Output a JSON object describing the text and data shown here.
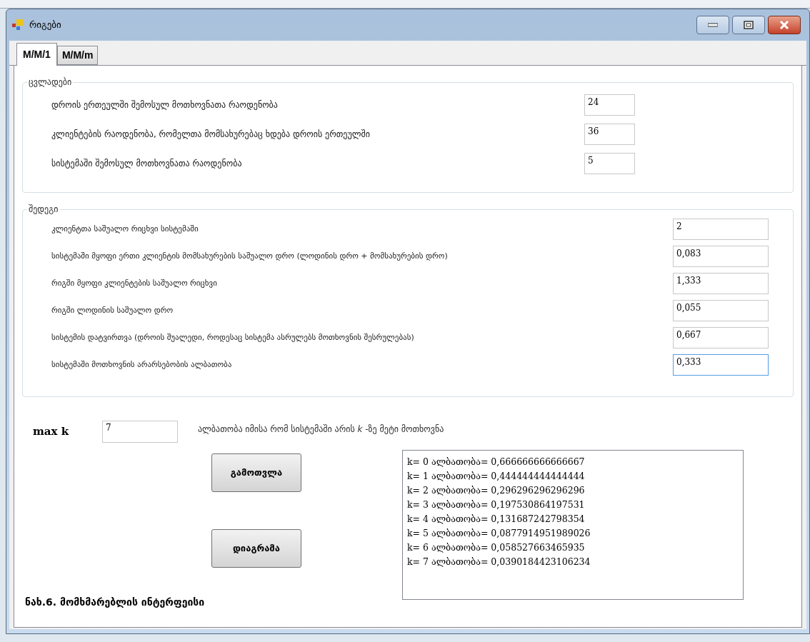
{
  "window": {
    "title": "რიგები"
  },
  "tabs": [
    {
      "label": "M/M/1",
      "selected": true
    },
    {
      "label": "M/M/m",
      "selected": false
    }
  ],
  "variables": {
    "title": "ცვლადები",
    "rows": [
      {
        "label": "დროის ერთეულში შემოსულ მოთხოვნათა რაოდენობა",
        "value": "24"
      },
      {
        "label": "კლიენტების რაოდენობა, რომელთა მომსახურებაც ხდება დროის ერთეულში",
        "value": "36"
      },
      {
        "label": "სისტემაში შემოსულ მოთხოვნათა რაოდენობა",
        "value": "5"
      }
    ]
  },
  "results": {
    "title": "შედეგი",
    "rows": [
      {
        "label": "კლიენტთა საშუალო რიცხვი სისტემაში",
        "value": "2",
        "focused": false
      },
      {
        "label": "სისტემაში მყოფი ერთი კლიენტის მომსახურების საშუალო დრო (ლოდინის დრო + მომსახურების დრო)",
        "value": "0,083",
        "focused": false
      },
      {
        "label": "რიგში მყოფი კლიენტების საშუალო რიცხვი",
        "value": "1,333",
        "focused": false
      },
      {
        "label": "რიგში ლოდინის საშუალო დრო",
        "value": "0,055",
        "focused": false
      },
      {
        "label": "სისტემის დატვირთვა (დროის შუალედი, როდესაც სისტემა ასრულებს მოთხოვნის შესრულებას)",
        "value": "0,667",
        "focused": false
      },
      {
        "label": "სისტემაში მოთხოვნის არარსებობის ალბათობა",
        "value": "0,333",
        "focused": true
      }
    ]
  },
  "max_k": {
    "label": "max k",
    "value": "7"
  },
  "probability_note": "ალბათობა იმისა რომ სისტემაში არის  *k* -ზე მეტი მოთხოვნა",
  "buttons": [
    "გამოთვლა",
    "დიაგრამა"
  ],
  "output_list": [
    "k= 0 ალბათობა= 0,666666666666667",
    "k= 1 ალბათობა= 0,444444444444444",
    "k= 2 ალბათობა= 0,296296296296296",
    "k= 3 ალბათობა= 0,197530864197531",
    "k= 4 ალბათობა= 0,131687242798354",
    "k= 5 ალბათობა= 0,0877914951989026",
    "k= 6 ალბათობა= 0,058527663465935",
    "k= 7 ალბათობა= 0,0390184423106234"
  ],
  "caption": "ნახ.6. მომხმარებლის ინტერფეისი"
}
